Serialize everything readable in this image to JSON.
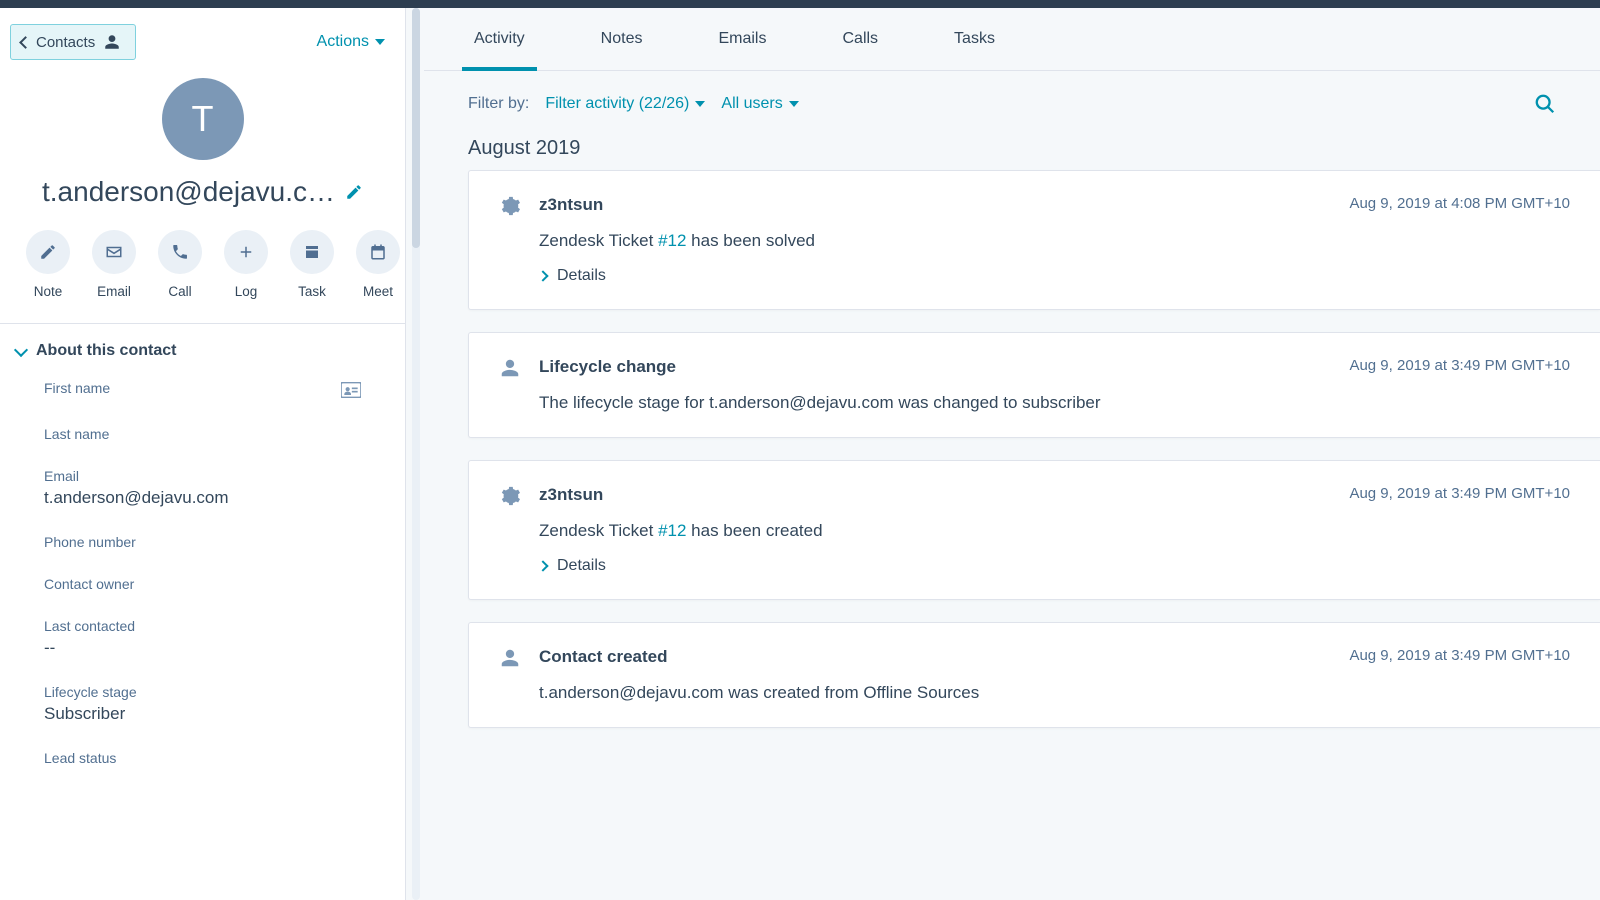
{
  "header": {
    "contacts_label": "Contacts",
    "actions_label": "Actions"
  },
  "profile": {
    "avatar_initial": "T",
    "title": "t.anderson@dejavu.c…"
  },
  "quick_actions": [
    {
      "name": "note",
      "label": "Note"
    },
    {
      "name": "email",
      "label": "Email"
    },
    {
      "name": "call",
      "label": "Call"
    },
    {
      "name": "log",
      "label": "Log"
    },
    {
      "name": "task",
      "label": "Task"
    },
    {
      "name": "meet",
      "label": "Meet"
    }
  ],
  "about": {
    "heading": "About this contact",
    "fields": {
      "first_name_label": "First name",
      "first_name_value": "",
      "last_name_label": "Last name",
      "last_name_value": "",
      "email_label": "Email",
      "email_value": "t.anderson@dejavu.com",
      "phone_label": "Phone number",
      "phone_value": "",
      "owner_label": "Contact owner",
      "owner_value": "",
      "last_contacted_label": "Last contacted",
      "last_contacted_value": "--",
      "lifecycle_label": "Lifecycle stage",
      "lifecycle_value": "Subscriber",
      "lead_status_label": "Lead status"
    }
  },
  "tabs": {
    "activity": "Activity",
    "notes": "Notes",
    "emails": "Emails",
    "calls": "Calls",
    "tasks": "Tasks"
  },
  "filter": {
    "label": "Filter by:",
    "activity": "Filter activity (22/26)",
    "users": "All users"
  },
  "timeline": {
    "month": "August 2019",
    "items": [
      {
        "icon": "gear",
        "title": "z3ntsun",
        "date": "Aug 9, 2019 at 4:08 PM GMT+10",
        "body_prefix": "Zendesk Ticket ",
        "ticket": "#12",
        "body_suffix": " has been solved",
        "details": "Details"
      },
      {
        "icon": "person",
        "title": "Lifecycle change",
        "date": "Aug 9, 2019 at 3:49 PM GMT+10",
        "body": "The lifecycle stage for t.anderson@dejavu.com was changed to subscriber"
      },
      {
        "icon": "gear",
        "title": "z3ntsun",
        "date": "Aug 9, 2019 at 3:49 PM GMT+10",
        "body_prefix": "Zendesk Ticket ",
        "ticket": "#12",
        "body_suffix": " has been created",
        "details": "Details"
      },
      {
        "icon": "person",
        "title": "Contact created",
        "date": "Aug 9, 2019 at 3:49 PM GMT+10",
        "body": "t.anderson@dejavu.com was created from Offline Sources"
      }
    ]
  }
}
